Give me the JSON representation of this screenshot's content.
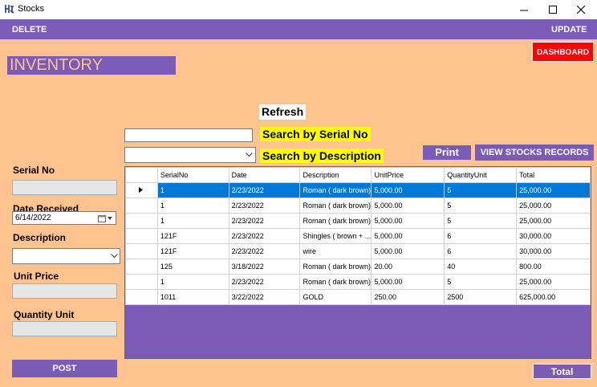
{
  "window": {
    "title": "Stocks"
  },
  "menu": {
    "delete": "DELETE",
    "update": "UPDATE"
  },
  "dashboard_button": "DASHBOARD",
  "page_title": "INVENTORY RECORD",
  "refresh_button": "Refresh",
  "search": {
    "serial_label": "Search by Serial No",
    "serial_value": "",
    "description_label": "Search by Description",
    "description_value": ""
  },
  "print_button": "Print",
  "view_stocks_button": "VIEW STOCKS RECORDS",
  "form": {
    "serial_label": "Serial No",
    "serial_value": "",
    "date_label": "Date Received",
    "date_value": "6/14/2022",
    "description_label": "Description",
    "description_value": "",
    "unit_price_label": "Unit Price",
    "unit_price_value": "",
    "quantity_label": "Quantity Unit",
    "quantity_value": "",
    "post_button": "POST"
  },
  "total_button": "Total",
  "grid": {
    "columns": [
      "SerialNo",
      "Date",
      "Description",
      "UnitPrice",
      "QuantityUnit",
      "Total"
    ],
    "rows": [
      [
        "1",
        "2/23/2022",
        "Roman ( dark brown)",
        "5,000.00",
        "5",
        "25,000.00"
      ],
      [
        "1",
        "2/23/2022",
        "Roman ( dark brown)",
        "5,000.00",
        "5",
        "25,000.00"
      ],
      [
        "1",
        "2/23/2022",
        "Roman ( dark brown)",
        "5,000.00",
        "5",
        "25,000.00"
      ],
      [
        "121F",
        "2/23/2022",
        "Shingles ( brown + ...",
        "5,000.00",
        "6",
        "30,000.00"
      ],
      [
        "121F",
        "2/23/2022",
        "wire",
        "5,000.00",
        "6",
        "30,000.00"
      ],
      [
        "125",
        "3/18/2022",
        "Roman ( dark brown)",
        "20.00",
        "40",
        "800.00"
      ],
      [
        "1",
        "2/23/2022",
        "Roman ( dark brown)",
        "5,000.00",
        "5",
        "25,000.00"
      ],
      [
        "1011",
        "3/22/2022",
        "GOLD",
        "250.00",
        "2500",
        "625,000.00"
      ]
    ],
    "selected_row": 0
  }
}
